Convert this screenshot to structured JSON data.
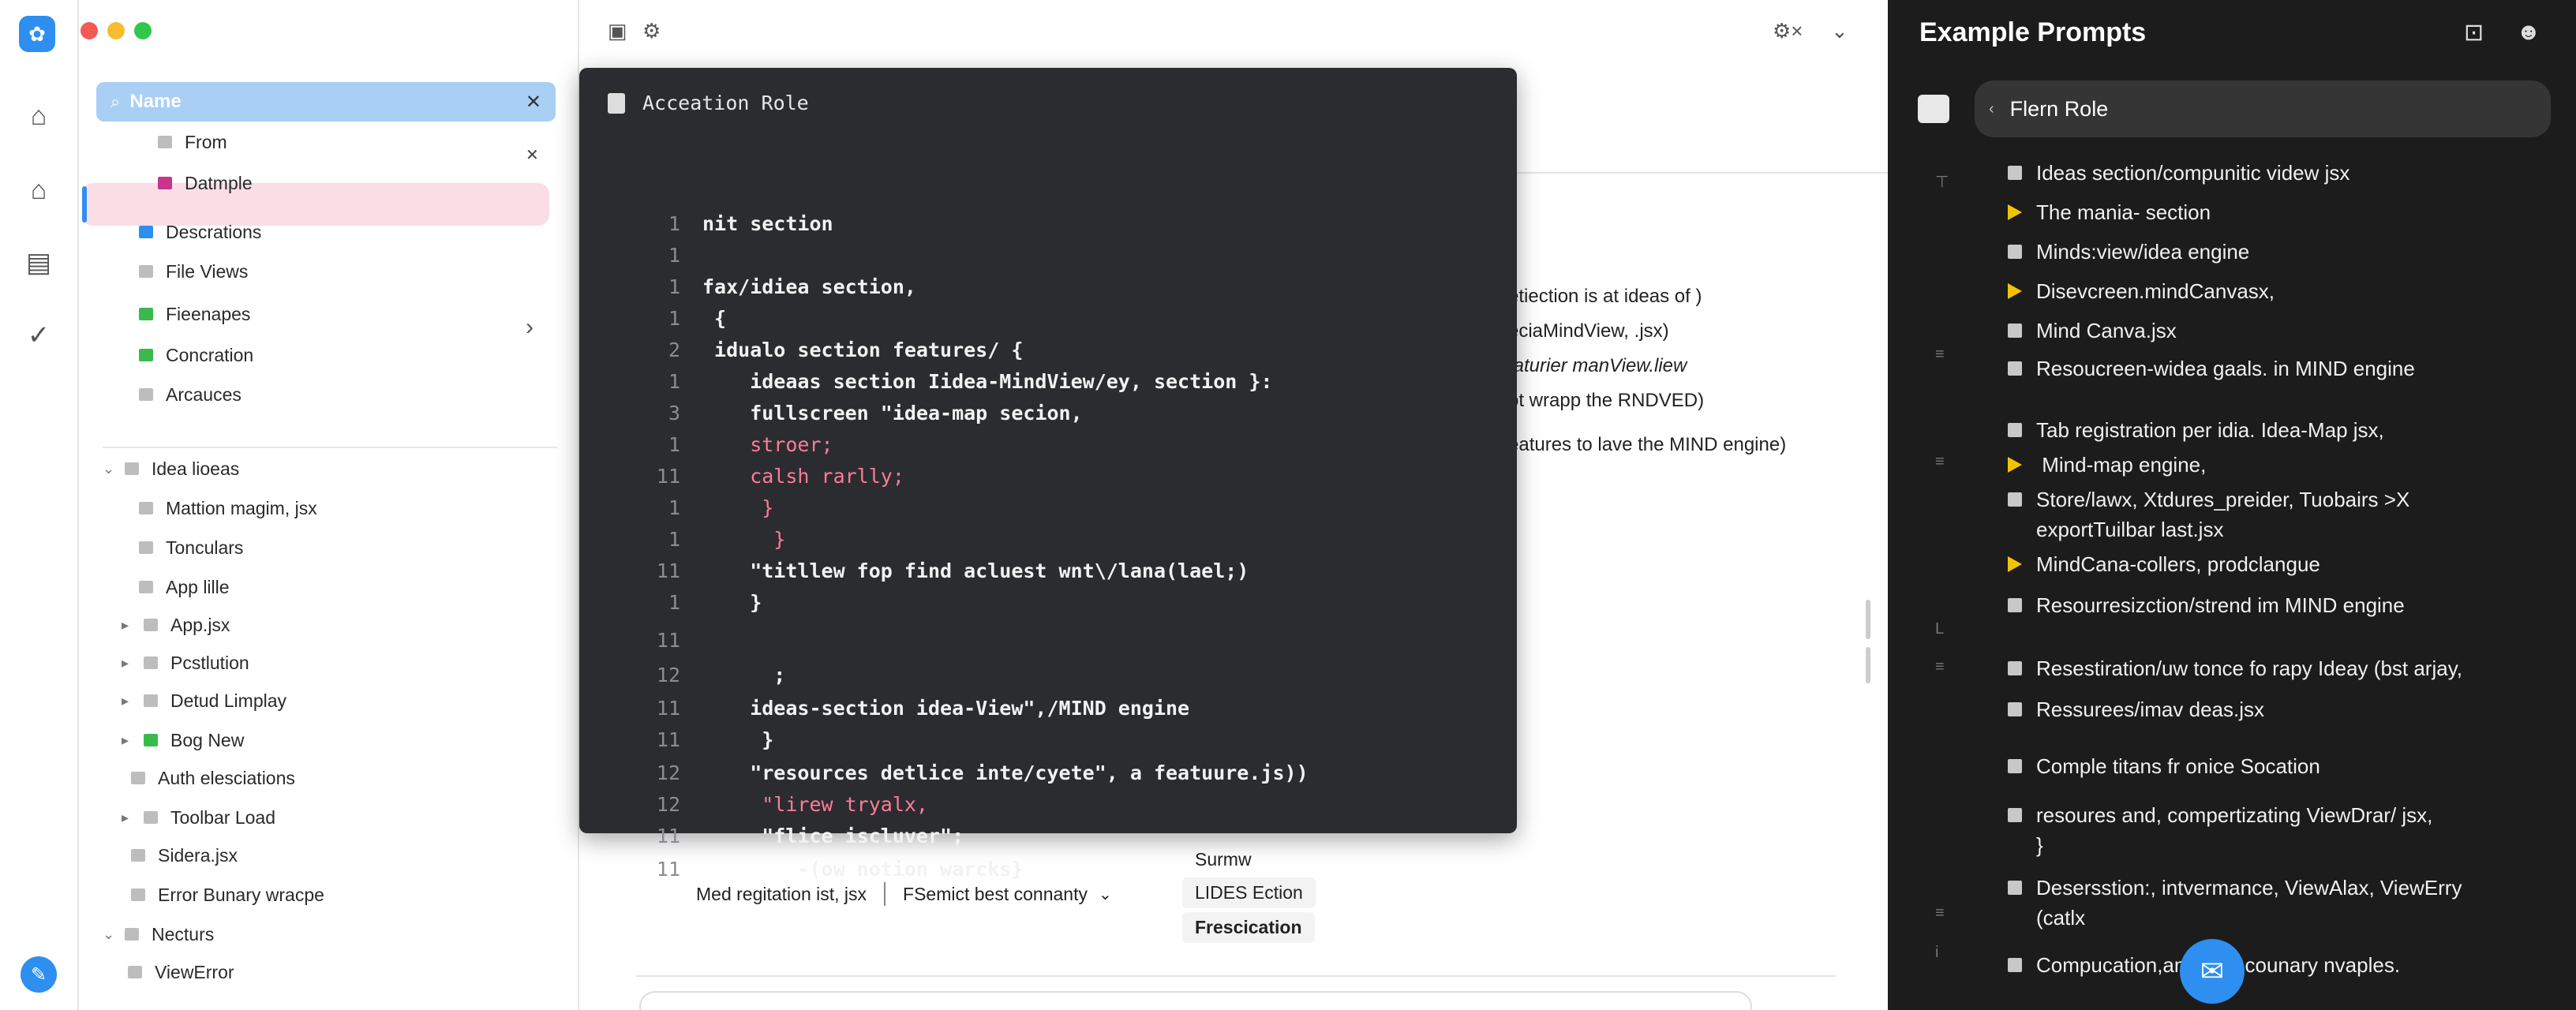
{
  "window": {
    "traffic_lights": [
      "#f25a52",
      "#f5bd2f",
      "#2fc84c"
    ]
  },
  "rail": {
    "items": [
      "home-icon",
      "house-icon",
      "inbox-icon",
      "check-icon"
    ],
    "bottom": "edit-icon"
  },
  "search": {
    "label": "Name"
  },
  "tree": {
    "rows": [
      {
        "label": "From",
        "color": "#bdbdbd",
        "x": 0
      },
      {
        "label": "Datmple",
        "color": "#c8358a",
        "x": 0
      },
      {
        "label": "Descrations",
        "color": "#2e8ff0",
        "x": 0
      },
      {
        "label": "File Views",
        "color": "#bdbdbd",
        "x": 0
      },
      {
        "label": "Fieenapes",
        "color": "#3aba4c",
        "x": 0
      },
      {
        "label": "Concration",
        "color": "#3aba4c",
        "x": 0
      },
      {
        "label": "Arcauces",
        "color": "#bdbdbd",
        "x": 0
      },
      {
        "label": "Idea lioeas",
        "color": "#bdbdbd",
        "x": 0
      },
      {
        "label": "Mattion magim, jsx",
        "color": "#bdbdbd",
        "x": 0
      },
      {
        "label": "Tonculars",
        "color": "#bdbdbd",
        "x": 0
      },
      {
        "label": "App lille",
        "color": "#bdbdbd",
        "x": 0
      },
      {
        "label": "App.jsx",
        "color": "#bdbdbd",
        "x": 0
      },
      {
        "label": "Pcstlution",
        "color": "#bdbdbd",
        "x": 0
      },
      {
        "label": "Detud Limplay",
        "color": "#bdbdbd",
        "x": 0
      },
      {
        "label": "Bog New",
        "color": "#3aba4c",
        "x": 0
      },
      {
        "label": "Auth elesciations",
        "color": "#bdbdbd",
        "x": 0
      },
      {
        "label": "Toolbar Load",
        "color": "#bdbdbd",
        "x": 0
      },
      {
        "label": "Sidera.jsx",
        "color": "#bdbdbd",
        "x": 0
      },
      {
        "label": "Error Bunary wracpe",
        "color": "#bdbdbd",
        "x": 0
      },
      {
        "label": "Necturs",
        "color": "#bdbdbd",
        "x": 0
      },
      {
        "label": "ViewError",
        "color": "#bdbdbd",
        "x": 0
      }
    ]
  },
  "code_panel": {
    "title": "Acceation Role",
    "lines": [
      {
        "n": "1",
        "t": "nit section",
        "pink": false
      },
      {
        "n": "1",
        "t": "",
        "pink": false
      },
      {
        "n": "1",
        "t": "fax/idiea section,",
        "pink": false
      },
      {
        "n": "1",
        "t": " {",
        "pink": false
      },
      {
        "n": "2",
        "t": " idualo section features/ {",
        "pink": false
      },
      {
        "n": "1",
        "t": "    ideaas section Iidea-MindView/ey, section }:",
        "pink": false
      },
      {
        "n": "3",
        "t": "    fullscreen \"idea-map secion,",
        "pink": false
      },
      {
        "n": "1",
        "t": "    stroer;",
        "pink": true
      },
      {
        "n": "11",
        "t": "    calsh rarlly;",
        "pink": true
      },
      {
        "n": "1",
        "t": "     }",
        "pink": true
      },
      {
        "n": "1",
        "t": "      }",
        "pink": true
      },
      {
        "n": "11",
        "t": "    \"titllew fop find acluest wnt\\/lana(lael;)",
        "pink": false
      },
      {
        "n": "1",
        "t": "    }",
        "pink": false
      },
      {
        "n": "11",
        "t": "",
        "pink": false
      },
      {
        "n": "12",
        "t": "      ;",
        "pink": false
      },
      {
        "n": "11",
        "t": "    ideas-section idea-View\",/MIND engine",
        "pink": false
      },
      {
        "n": "11",
        "t": "     }",
        "pink": false
      },
      {
        "n": "12",
        "t": "    \"resources detlice inte/cyete\", a featuure.js))",
        "pink": false
      },
      {
        "n": "12",
        "t": "     \"lirew tryalx,",
        "pink": true
      },
      {
        "n": "11",
        "t": "     \"flice iscluver\";",
        "pink": false
      },
      {
        "n": "11",
        "t": "        -(ow notion warcks}",
        "pink": false
      }
    ]
  },
  "main": {
    "peek_lines": [
      "etiection is at ideas of )",
      "eciaMindView, .jsx)",
      "faturier manView.liew",
      "ot wrapp the RNDVED)",
      "eatures to lave the MIND engine)"
    ],
    "bottom_left": "Med regitation ist, jsx",
    "bottom_mid": "FSemict best connanty",
    "chips": [
      "Surmw",
      "LIDES Ection",
      "Frescication"
    ]
  },
  "right_panel": {
    "title": "Example Prompts",
    "role": "Flern Role",
    "items": [
      {
        "text": "Ideas section/compunitic videw jsx",
        "tri": false
      },
      {
        "text": "The mania- section",
        "tri": true
      },
      {
        "text": "Minds:view/idea engine",
        "tri": false
      },
      {
        "text": "Disevcreen.mindCanvasx,",
        "tri": true
      },
      {
        "text": "Mind Canva.jsx",
        "tri": false
      },
      {
        "text": "Resoucreen-widea gaals. in MIND engine",
        "tri": false
      },
      {
        "text": "Tab registration per idia. Idea-Map jsx,",
        "tri": false
      },
      {
        "text": " Mind-map engine,",
        "tri": true
      },
      {
        "text": "Store/lawx, Xtdures_preider, Tuobairs >X\nexportTuilbar last.jsx",
        "tri": false
      },
      {
        "text": "MindCana-collers, prodclangue",
        "tri": true
      },
      {
        "text": "Resourresizction/strend im MIND engine",
        "tri": false
      },
      {
        "text": "Resestiration/uw tonce fo rapy Ideay (bst arjay,",
        "tri": false
      },
      {
        "text": "Ressurees/imav deas.jsx",
        "tri": false
      },
      {
        "text": "Comple titans fr onice Socation",
        "tri": false
      },
      {
        "text": "resoures and, compertizating ViewDrar/ jsx,\n}",
        "tri": false
      },
      {
        "text": "Desersstion:, intvermance, ViewAlax, ViewErry\n(catlx",
        "tri": false
      },
      {
        "text": "Compucation,ancivate counary nvaples.",
        "tri": false
      }
    ]
  }
}
